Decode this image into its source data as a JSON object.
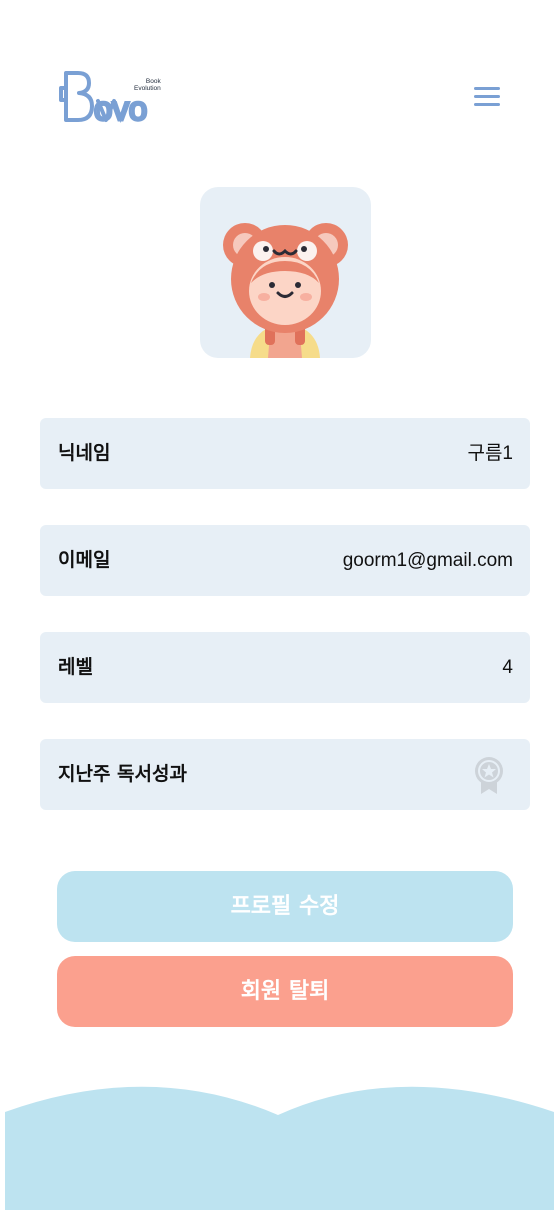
{
  "header": {
    "logo_wordmark": "Bovo",
    "logo_tag_line1": "Book",
    "logo_tag_line2": "Evolution",
    "menu_icon": "hamburger-menu-icon"
  },
  "profile": {
    "avatar_icon": "bear-costume-kid-avatar",
    "fields": [
      {
        "label": "닉네임",
        "value": "구름1"
      },
      {
        "label": "이메일",
        "value": "goorm1@gmail.com"
      },
      {
        "label": "레벨",
        "value": "4"
      },
      {
        "label": "지난주 독서성과",
        "icon": "award-ribbon-icon"
      }
    ]
  },
  "actions": {
    "edit_profile": "프로필 수정",
    "withdraw": "회원 탈퇴"
  },
  "colors": {
    "accent": "#7aa0d4",
    "field_bg": "#e7eff6",
    "edit_button": "#bde3f0",
    "withdraw_button": "#fba08e",
    "footer_wave": "#bde3f0"
  }
}
